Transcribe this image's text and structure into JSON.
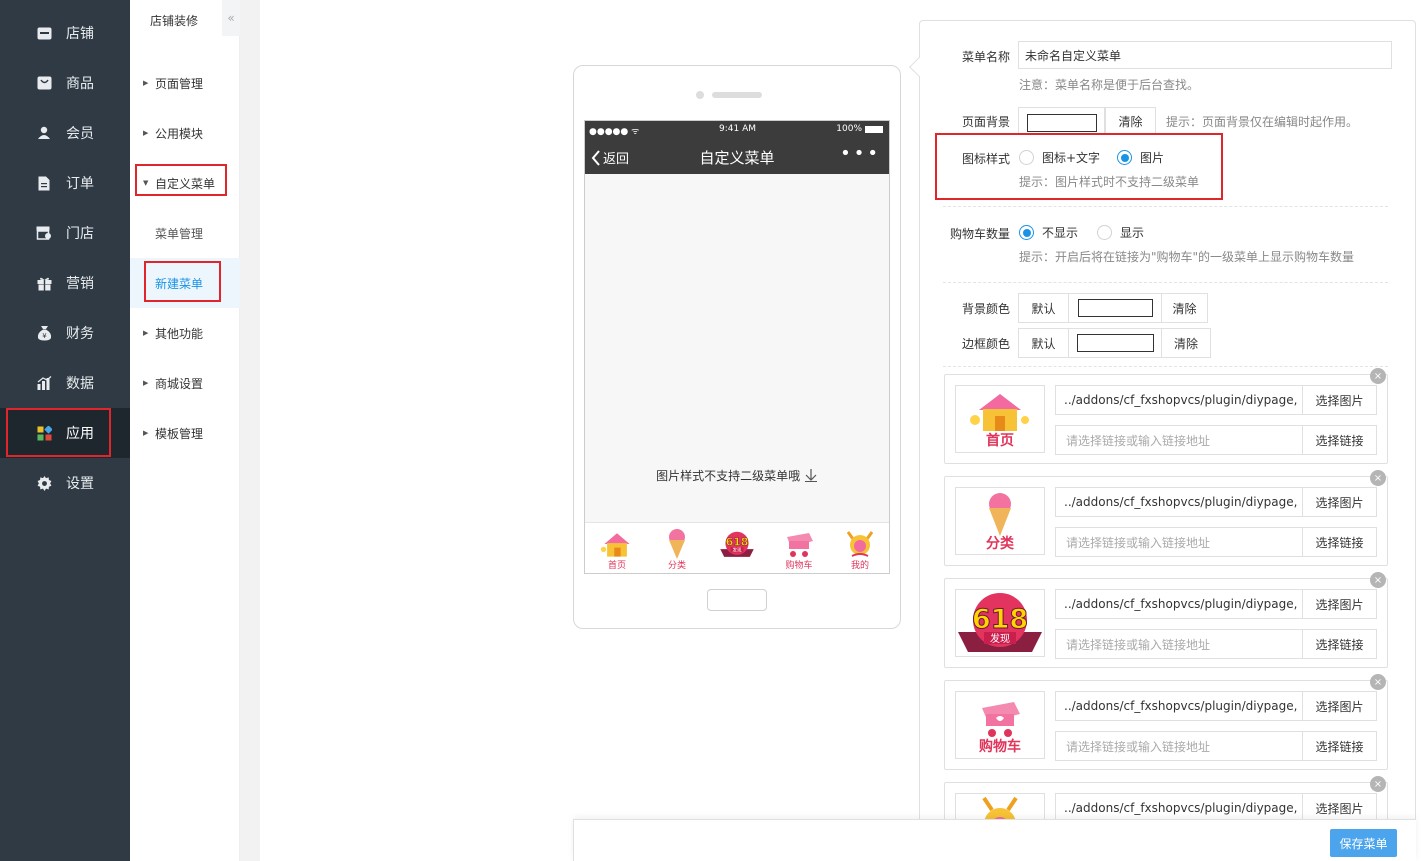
{
  "nav": {
    "items": [
      {
        "label": "店铺",
        "icon": "store-icon"
      },
      {
        "label": "商品",
        "icon": "goods-icon"
      },
      {
        "label": "会员",
        "icon": "member-icon"
      },
      {
        "label": "订单",
        "icon": "order-icon"
      },
      {
        "label": "门店",
        "icon": "shop-icon"
      },
      {
        "label": "营销",
        "icon": "gift-icon"
      },
      {
        "label": "财务",
        "icon": "money-bag-icon"
      },
      {
        "label": "数据",
        "icon": "bar-chart-icon"
      },
      {
        "label": "应用",
        "icon": "apps-icon"
      },
      {
        "label": "设置",
        "icon": "gear-icon"
      }
    ],
    "active": "应用",
    "colors": {
      "bg": "#2f3a44",
      "active_bg": "#1f272e",
      "highlight": "#e0262b"
    }
  },
  "subnav": {
    "title": "店铺装修",
    "collapse_glyph": "«",
    "items": [
      {
        "label": "页面管理"
      },
      {
        "label": "公用模块"
      },
      {
        "label": "自定义菜单"
      },
      {
        "label": "菜单管理"
      },
      {
        "label": "新建菜单"
      },
      {
        "label": "其他功能"
      },
      {
        "label": "商城设置"
      },
      {
        "label": "模板管理"
      }
    ]
  },
  "phone": {
    "status": {
      "carrier": "●●●●● ᯤ",
      "time": "9:41 AM",
      "battery": "100%"
    },
    "back_label": "返回",
    "title": "自定义菜单",
    "more": "•••",
    "hint": "图片样式不支持二级菜单哦",
    "tabs": [
      {
        "caption": "首页",
        "icon": "house-icon"
      },
      {
        "caption": "分类",
        "icon": "ice-cream-icon"
      },
      {
        "caption": "",
        "icon": "618-badge-icon"
      },
      {
        "caption": "购物车",
        "icon": "cart-icon"
      },
      {
        "caption": "我的",
        "icon": "profile-icon"
      }
    ]
  },
  "form": {
    "menu_name": {
      "label": "菜单名称",
      "value": "未命名自定义菜单",
      "note": "注意：菜单名称是便于后台查找。"
    },
    "page_bg": {
      "label": "页面背景",
      "clear": "清除",
      "tip": "提示：页面背景仅在编辑时起作用。"
    },
    "icon_style": {
      "label": "图标样式",
      "options": [
        "图标+文字",
        "图片"
      ],
      "selected": "图片",
      "tip": "提示：图片样式时不支持二级菜单"
    },
    "cart_count": {
      "label": "购物车数量",
      "options": [
        "不显示",
        "显示"
      ],
      "selected": "不显示",
      "tip": "提示：开启后将在链接为\"购物车\"的一级菜单上显示购物车数量"
    },
    "bg_color": {
      "label": "背景颜色",
      "default": "默认",
      "clear": "清除"
    },
    "border_color": {
      "label": "边框颜色",
      "default": "默认",
      "clear": "清除"
    }
  },
  "menu_items": [
    {
      "caption": "首页",
      "icon": "house-icon",
      "path": "../addons/cf_fxshopvcs/plugin/diypage,",
      "link_placeholder": "请选择链接或输入链接地址"
    },
    {
      "caption": "分类",
      "icon": "ice-cream-icon",
      "path": "../addons/cf_fxshopvcs/plugin/diypage,",
      "link_placeholder": "请选择链接或输入链接地址"
    },
    {
      "caption": "",
      "icon": "618-badge-icon",
      "path": "../addons/cf_fxshopvcs/plugin/diypage,",
      "link_placeholder": "请选择链接或输入链接地址"
    },
    {
      "caption": "购物车",
      "icon": "cart-icon",
      "path": "../addons/cf_fxshopvcs/plugin/diypage,",
      "link_placeholder": "请选择链接或输入链接地址"
    },
    {
      "caption": "",
      "icon": "profile-icon",
      "path": "../addons/cf_fxshopvcs/plugin/diypage,",
      "link_placeholder": "请选择链接或输入链接地址"
    }
  ],
  "card_actions": {
    "pick_image": "选择图片",
    "pick_link": "选择链接",
    "close": "×"
  },
  "footer": {
    "save": "保存菜单"
  },
  "colors": {
    "accent": "#1a93e6",
    "save_btn": "#4ba4ec",
    "caption_pink": "#e0345a"
  }
}
